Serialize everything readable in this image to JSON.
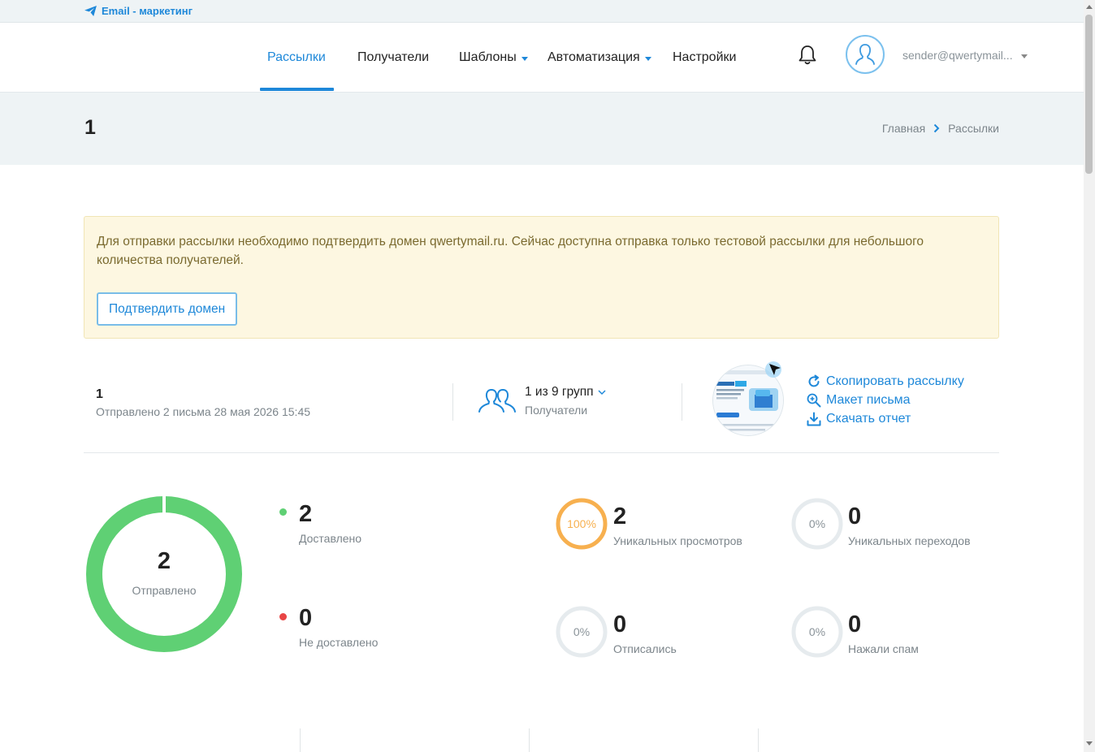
{
  "app": {
    "brand": "Email - маркетинг"
  },
  "nav": {
    "items": [
      {
        "label": "Рассылки"
      },
      {
        "label": "Получатели"
      },
      {
        "label": "Шаблоны"
      },
      {
        "label": "Автоматизация"
      },
      {
        "label": "Настройки"
      }
    ],
    "user_email": "sender@qwertymail..."
  },
  "page": {
    "title": "1",
    "breadcrumb": [
      "Главная",
      "Рассылки"
    ]
  },
  "alert": {
    "text": "Для отправки рассылки необходимо подтвердить домен qwertymail.ru. Сейчас доступна отправка только тестовой рассылки для небольшого количества получателей.",
    "button": "Подтвердить домен"
  },
  "campaign": {
    "name": "1",
    "sent_info": "Отправлено 2 письма 28 мая 2026 15:45",
    "groups": "1 из 9 групп",
    "groups_label": "Получатели",
    "actions": {
      "copy": "Скопировать рассылку",
      "layout": "Макет письма",
      "report": "Скачать отчет"
    }
  },
  "stats": {
    "sent": {
      "value": "2",
      "label": "Отправлено"
    },
    "delivered": {
      "value": "2",
      "label": "Доставлено"
    },
    "not_delivered": {
      "value": "0",
      "label": "Не доставлено"
    },
    "unique_views": {
      "value": "2",
      "label": "Уникальных просмотров",
      "percent": "100%"
    },
    "unique_clicks": {
      "value": "0",
      "label": "Уникальных переходов",
      "percent": "0%"
    },
    "unsubscribed": {
      "value": "0",
      "label": "Отписались",
      "percent": "0%"
    },
    "spam": {
      "value": "0",
      "label": "Нажали спам",
      "percent": "0%"
    }
  },
  "colors": {
    "accent": "#1e88d9",
    "success": "#5fd074",
    "danger": "#e84545",
    "warning": "#f7b04f"
  }
}
